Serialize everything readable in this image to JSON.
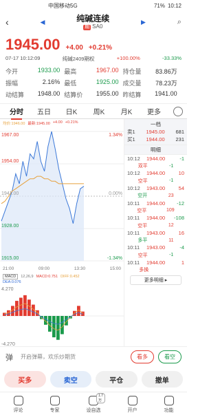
{
  "status": {
    "carrier": "中国移动5G",
    "battery": "71%",
    "time": "10:12"
  },
  "header": {
    "title": "纯碱连续",
    "tag": "期",
    "code": "SA0"
  },
  "price": {
    "last": "1945.00",
    "change": "+4.00",
    "change_pct": "+0.21%"
  },
  "timeline": {
    "datetime": "07-17 10:12:09",
    "contract": "纯碱2409期权",
    "pct1": "+100.00%",
    "pct2": "-33.33%"
  },
  "stats": [
    [
      {
        "label": "今开",
        "value": "1933.00",
        "color": "green"
      },
      {
        "label": "最高",
        "value": "1967.00",
        "color": "red"
      },
      {
        "label": "持仓量",
        "value": "83.86万",
        "color": "plain"
      }
    ],
    [
      {
        "label": "振幅",
        "value": "2.16%",
        "color": "plain"
      },
      {
        "label": "最低",
        "value": "1925.00",
        "color": "green"
      },
      {
        "label": "成交量",
        "value": "78.23万",
        "color": "plain"
      }
    ],
    [
      {
        "label": "动结算",
        "value": "1948.00",
        "color": "plain"
      },
      {
        "label": "结算价",
        "value": "1955.00",
        "color": "plain"
      },
      {
        "label": "昨结算",
        "value": "1941.00",
        "color": "plain"
      }
    ]
  ],
  "tabs": [
    "分时",
    "五日",
    "日K",
    "周K",
    "月K",
    "更多"
  ],
  "legend": {
    "avg": "均价:1946.00",
    "latest": "最新:1945.00",
    "chg": "+4.00",
    "pct": "+0.21%"
  },
  "chart_axes": {
    "y_top": "1967.00",
    "y_mid": "1954.00",
    "y_base": "1941.00",
    "y_low": "1928.00",
    "y_bottom": "1915.00",
    "pct_top": "1.34%",
    "pct_mid": "0.00%",
    "pct_bottom": "-1.34%",
    "times": [
      "21:00",
      "09:00",
      "13:30",
      "15:00"
    ]
  },
  "macd": {
    "title": "MACD",
    "params": "12,26,9",
    "macd": "MACD:0.751",
    "diff": "DIFF:0.452",
    "dea": "DEA:0.076",
    "top": "4.270",
    "bottom": "-4.270"
  },
  "chart_data": {
    "type": "line",
    "ylim": [
      1915,
      1967
    ],
    "series": [
      {
        "values": [
          1931,
          1935,
          1939,
          1943,
          1950,
          1946,
          1955,
          1949,
          1958,
          1956,
          1963,
          1955,
          1951,
          1961,
          1967,
          1960,
          1952,
          1946,
          1940,
          1936,
          1930,
          1938,
          1944,
          1945
        ]
      },
      {
        "values": [
          1938,
          1939,
          1941,
          1943,
          1944,
          1945,
          1946,
          1947,
          1948,
          1948,
          1949,
          1949,
          1948,
          1948,
          1947,
          1947,
          1946,
          1946,
          1946,
          1946,
          1946,
          1946,
          1946,
          1946
        ]
      }
    ],
    "macd_values": [
      0.5,
      0.9,
      1.6,
      2.4,
      2.9,
      3.3,
      2.6,
      1.8,
      0.9,
      -0.5,
      -1.4,
      -2.5,
      -3.4,
      -3.8,
      -2.9,
      -1.5,
      -0.4,
      0.8,
      1.6,
      0.7
    ]
  },
  "orderbook": {
    "header": "一档",
    "rows": [
      {
        "label": "卖1",
        "price": "1945.00",
        "vol": "681"
      },
      {
        "label": "买1",
        "price": "1944.00",
        "vol": "231"
      }
    ]
  },
  "trades_header": "明细",
  "trades": [
    {
      "t": "10:12",
      "p": "1944.00",
      "v": "-1",
      "vg": true
    },
    {
      "k": "双平",
      "kc": "r",
      "v": "-1",
      "vg": true
    },
    {
      "t": "10:12",
      "p": "1944.00",
      "v": "10",
      "vg": false
    },
    {
      "k": "空平",
      "kc": "r",
      "v": "-1",
      "vg": true
    },
    {
      "t": "10:12",
      "p": "1943.00",
      "v": "54",
      "vg": false
    },
    {
      "k": "空开",
      "kc": "g",
      "v": "23",
      "vg": false
    },
    {
      "t": "10:11",
      "p": "1944.00",
      "v": "-12",
      "vg": true
    },
    {
      "k": "空平",
      "kc": "r",
      "v": "109",
      "vg": false
    },
    {
      "t": "10:11",
      "p": "1944.00",
      "v": "-108",
      "vg": true
    },
    {
      "k": "空平",
      "kc": "r",
      "v": "12",
      "vg": false
    },
    {
      "t": "10:11",
      "p": "1943.00",
      "v": "16",
      "vg": false
    },
    {
      "k": "多平",
      "kc": "g",
      "v": "11",
      "vg": false
    },
    {
      "t": "10:11",
      "p": "1943.00",
      "v": "-4",
      "vg": true
    },
    {
      "k": "空平",
      "kc": "r",
      "v": "-1",
      "vg": true
    },
    {
      "t": "10:11",
      "p": "1944.00",
      "v": "1",
      "vg": false
    },
    {
      "k": "多换",
      "kc": "r",
      "v": "",
      "vg": false
    }
  ],
  "more_detail": "更多明细 ▸",
  "comment": {
    "hint": "开启弹幕，欢乐炒期货",
    "bull": "看多",
    "bear": "看空"
  },
  "actions": [
    "买多",
    "卖空",
    "平仓",
    "撤单"
  ],
  "bottomnav": [
    {
      "label": "评论",
      "badge": ""
    },
    {
      "label": "专家",
      "badge": ""
    },
    {
      "label": "设自选",
      "badge": "1.7万"
    },
    {
      "label": "开户",
      "badge": ""
    },
    {
      "label": "功能",
      "badge": ""
    }
  ]
}
